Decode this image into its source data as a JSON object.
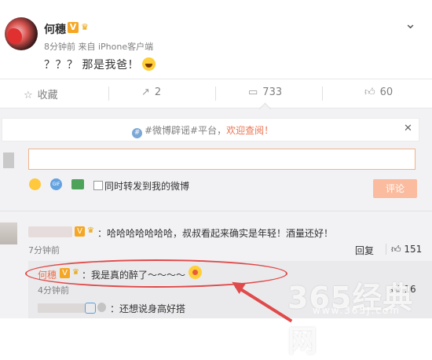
{
  "post": {
    "author": "何穗",
    "time": "8分钟前",
    "source": "来自 iPhone客户端",
    "content": "？？？ 那是我爸！",
    "badge": "V"
  },
  "actions": {
    "favorite": "收藏",
    "share": "2",
    "comments": "733",
    "likes": "60"
  },
  "notice": {
    "hashtag": "#微博辟谣#平台，",
    "cta": "欢迎查阅！"
  },
  "composer": {
    "placeholder": "",
    "sync_label": "同时转发到我的微博",
    "submit": "评论"
  },
  "comments": [
    {
      "text": "：哈哈哈哈哈哈哈，叔叔看起来确实是年轻！酒量还好！",
      "time": "7分钟前",
      "reply": "回复",
      "likes": "151",
      "badge": "V"
    }
  ],
  "replies": [
    {
      "author": "何穗",
      "text": "：我是真的醉了～～～～",
      "time": "4分钟前",
      "likes": "16",
      "badge": "V"
    },
    {
      "text": "：还想说身高好搭"
    }
  ],
  "watermark": {
    "brand": "365经典网",
    "url": "www.365J.com"
  },
  "colors": {
    "accent": "#eb7350",
    "highlight": "#e04a4a",
    "verified": "#f5a623"
  }
}
